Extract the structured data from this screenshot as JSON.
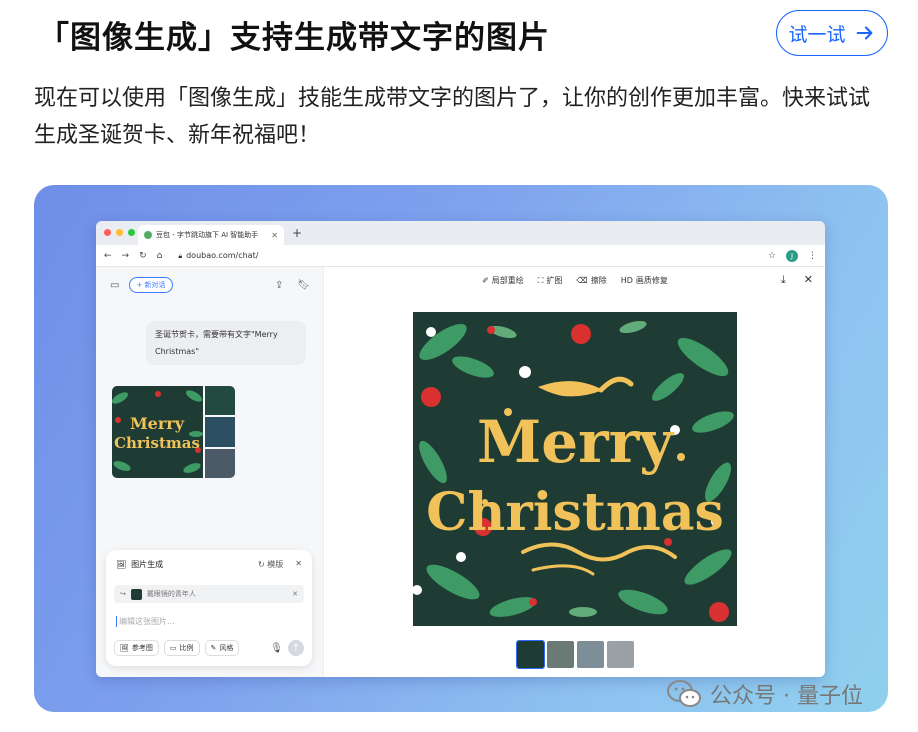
{
  "header": {
    "title": "「图像生成」支持生成带文字的图片",
    "try_button": "试一试"
  },
  "intro": "现在可以使用「图像生成」技能生成带文字的图片了，让你的创作更加丰富。快来试试生成圣诞贺卡、新年祝福吧！",
  "browser": {
    "tab_title": "豆包 - 字节跳动旗下 AI 智能助手",
    "url": "doubao.com/chat/",
    "avatar_letter": "J"
  },
  "sidebar": {
    "new_chat": "新对话",
    "user_message": "圣诞节贺卡，需要带有文字\"Merry Christmas\""
  },
  "composer": {
    "title": "图片生成",
    "template_label": "模版",
    "reference_text": "戴眼镜的青年人",
    "placeholder": "编辑这张图片...",
    "tools": [
      "参考图",
      "比例",
      "风格"
    ]
  },
  "viewer": {
    "tools": [
      "局部重绘",
      "扩图",
      "擦除",
      "画质修复"
    ]
  },
  "card_text": {
    "line1": "Merry",
    "line2": "Christmas"
  },
  "watermark": {
    "brand": "公众号 · 量子位"
  },
  "colors": {
    "accent": "#1a66ff",
    "card_bg": "#1e3c33",
    "card_text": "#f2c25a"
  }
}
